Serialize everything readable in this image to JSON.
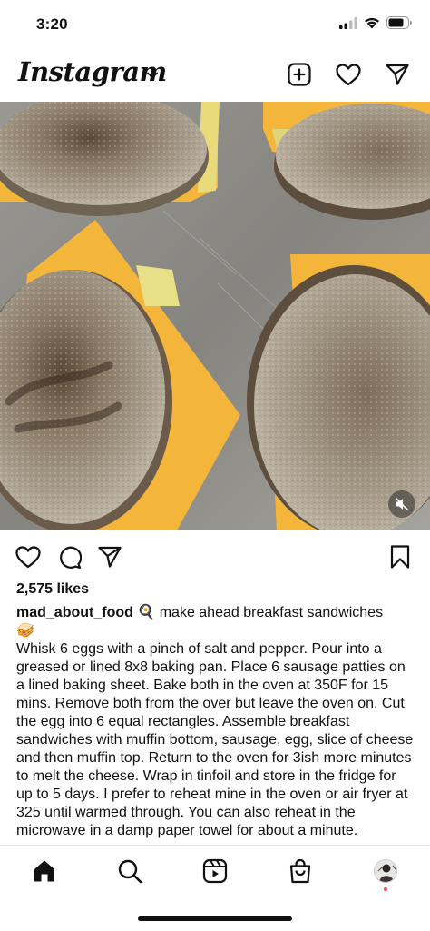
{
  "status": {
    "time": "3:20",
    "icons": [
      "signal-icon",
      "wifi-icon",
      "battery-icon"
    ]
  },
  "header": {
    "logo_text": "Instagram",
    "actions": [
      "new-post-icon",
      "heart-icon",
      "direct-message-icon"
    ]
  },
  "post": {
    "media_description_icons": [
      "muted-audio-icon"
    ],
    "likes": "2,575 likes",
    "username": "mad_about_food",
    "headline": " make ahead breakfast sandwiches ",
    "emoji_after_username": "🍳",
    "emoji_after_headline": "🥪",
    "body": "Whisk 6 eggs with a pinch of salt and pepper. Pour into a greased or lined 8x8 baking pan. Place 6 sausage patties on a lined baking sheet. Bake both in the oven at 350F for 15 mins. Remove both from the over but leave the oven on. Cut the egg into 6 equal rectangles. Assemble breakfast sandwiches with muffin bottom, sausage, egg, slice of cheese and then muffin top. Return to the oven for 3ish more minutes to melt the cheese. Wrap in tinfoil and store in the fridge for up to 5 days. I prefer to reheat mine in the oven or air fryer at 325 until warmed through. You can also reheat in the microwave in a damp paper towel for about a minute."
  },
  "nav": {
    "items": [
      "home-icon",
      "search-icon",
      "reels-icon",
      "shop-icon",
      "profile-avatar"
    ]
  },
  "colors": {
    "cheese": "#f6b93a",
    "muffin": "#a59c8c",
    "tray": "#8f8d88",
    "notification": "#ed4956"
  }
}
